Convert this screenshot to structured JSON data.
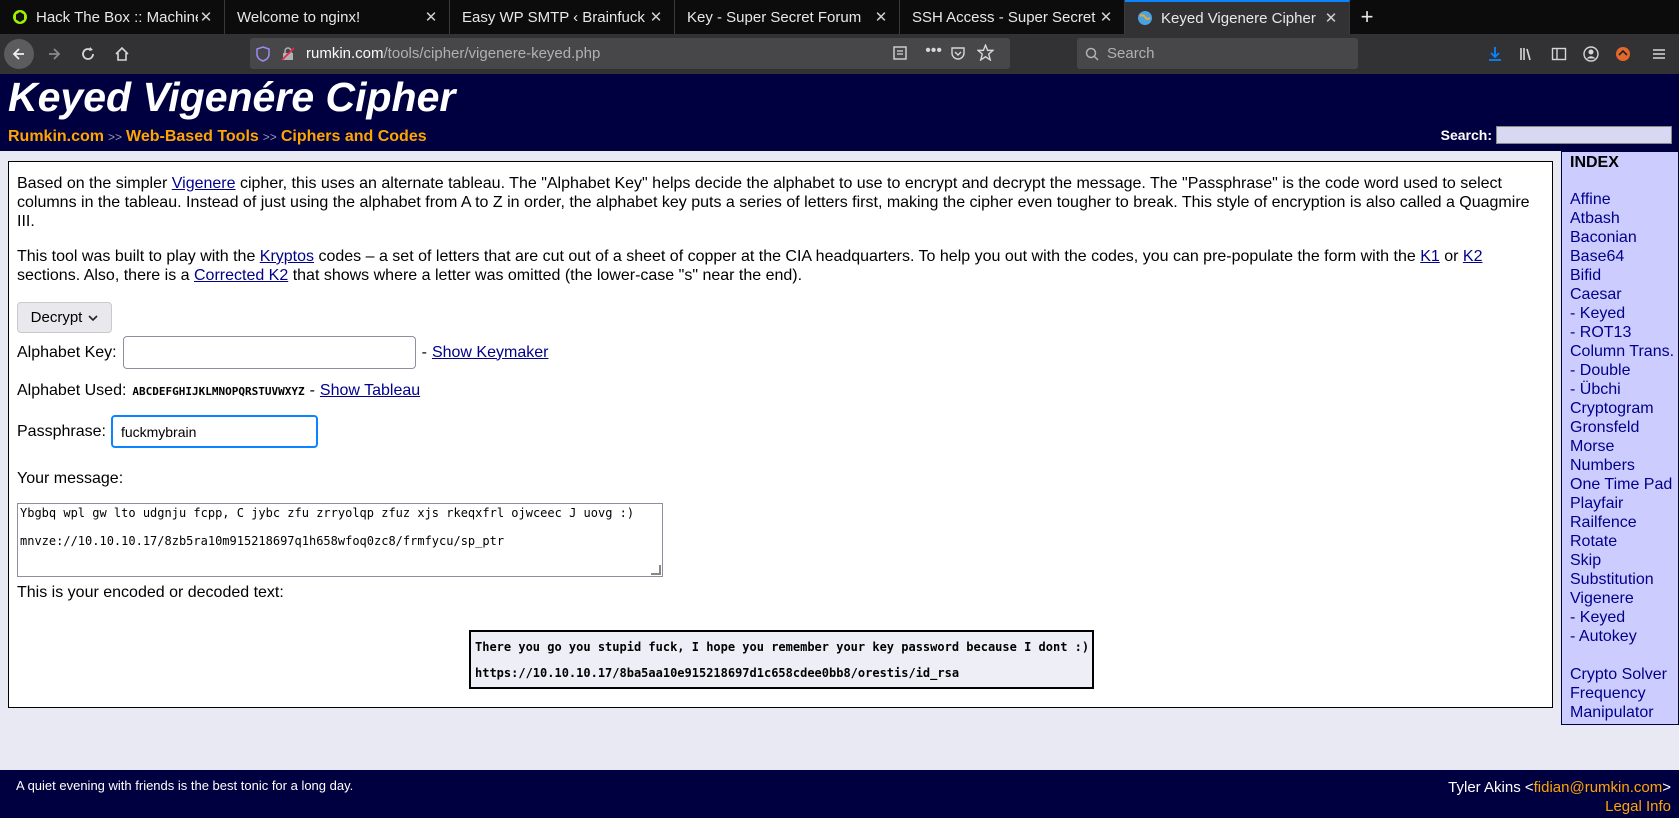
{
  "browser": {
    "tabs": [
      {
        "title": "Hack The Box :: Machines",
        "active": false,
        "favicon": "htb-cube-icon"
      },
      {
        "title": "Welcome to nginx!",
        "active": false
      },
      {
        "title": "Easy WP SMTP ‹ Brainfuck L",
        "active": false
      },
      {
        "title": "Key - Super Secret Forum",
        "active": false
      },
      {
        "title": "SSH Access - Super Secret F",
        "active": false
      },
      {
        "title": "Keyed Vigenere Cipher",
        "active": true,
        "favicon": "globe-icon"
      }
    ],
    "url_host": "rumkin.com",
    "url_path": "/tools/cipher/vigenere-keyed.php",
    "search_placeholder": "Search",
    "accent_color": "#0a84ff"
  },
  "header": {
    "title": "Keyed Vigenére Cipher",
    "breadcrumb": [
      "Rumkin.com",
      "Web-Based Tools",
      "Ciphers and Codes"
    ],
    "breadcrumb_sep": ">>",
    "search_label": "Search:"
  },
  "content": {
    "para1": {
      "t1": "Based on the simpler ",
      "link_vigenere": "Vigenere",
      "t2": " cipher, this uses an alternate tableau. The \"Alphabet Key\" helps decide the alphabet to use to encrypt and decrypt the message. The \"Passphrase\" is the code word used to select columns in the tableau. Instead of just using the alphabet from A to Z in order, the alphabet key puts a series of letters first, making the cipher even tougher to break. This style of encryption is also called a Quagmire III."
    },
    "para2": {
      "t1": "This tool was built to play with the ",
      "link_kryptos": "Kryptos",
      "t2": " codes – a set of letters that are cut out of a sheet of copper at the CIA headquarters. To help you out with the codes, you can pre-populate the form with the ",
      "link_k1": "K1",
      "t3": " or ",
      "link_k2": "K2",
      "t4": " sections. Also, there is a ",
      "link_corrected": "Corrected K2",
      "t5": " that shows where a letter was omitted (the lower-case \"s\" near the end)."
    },
    "mode_select": "Decrypt",
    "alphabet_key_label": "Alphabet Key:",
    "alphabet_key_value": "",
    "show_keymaker": "Show Keymaker",
    "dash": "-",
    "alphabet_used_label": "Alphabet Used:",
    "alphabet_used_value": "ABCDEFGHIJKLMNOPQRSTUVWXYZ",
    "show_tableau": "Show Tableau",
    "passphrase_label": "Passphrase:",
    "passphrase_value": "fuckmybrain",
    "message_label": "Your message:",
    "message_line1": "Ybgbq wpl gw lto udgnju fcpp, C jybc zfu zrryolqp zfuz xjs rkeqxfrl ojwceec J uovg :)",
    "message_line2": "mnvze://10.10.10.17/8zb5ra10m915218697q1h658wfoq0zc8/frmfycu/sp_ptr",
    "output_label": "This is your encoded or decoded text:",
    "output_line1": "There you go you stupid fuck, I hope you remember your key password because I dont :)",
    "output_line2": "https://10.10.10.17/8ba5aa10e915218697d1c658cdee0bb8/orestis/id_rsa"
  },
  "sidebar": {
    "title": "INDEX",
    "items": [
      "Affine",
      "Atbash",
      "Baconian",
      "Base64",
      "Bifid",
      "Caesar",
      "- Keyed",
      "- ROT13",
      "Column Trans.",
      "- Double",
      "- Übchi",
      "Cryptogram",
      "Gronsfeld",
      "Morse",
      "Numbers",
      "One Time Pad",
      "Playfair",
      "Railfence",
      "Rotate",
      "Skip",
      "Substitution",
      "Vigenere",
      "- Keyed",
      "- Autokey"
    ],
    "items2": [
      "Crypto Solver",
      "Frequency",
      "Manipulator"
    ]
  },
  "footer": {
    "quote": "A quiet evening with friends is the best tonic for a long day.",
    "author": "Tyler Akins <",
    "email": "fidian@rumkin.com",
    "author_end": ">",
    "legal": "Legal Info"
  }
}
